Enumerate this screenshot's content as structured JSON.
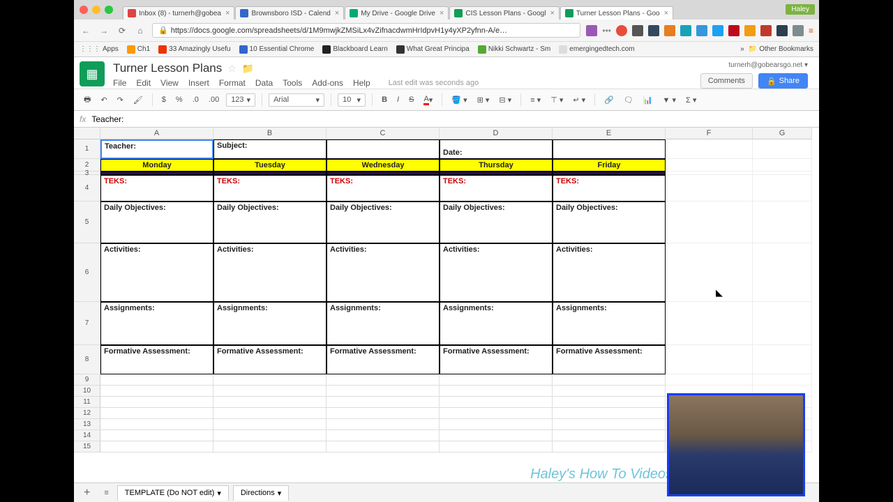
{
  "browser": {
    "user_badge": "Haley",
    "tabs": [
      {
        "label": "Inbox (8) - turnerh@gobea"
      },
      {
        "label": "Brownsboro ISD - Calend"
      },
      {
        "label": "My Drive - Google Drive"
      },
      {
        "label": "CIS Lesson Plans - Googl"
      },
      {
        "label": "Turner Lesson Plans - Goo"
      }
    ],
    "url": "https://docs.google.com/spreadsheets/d/1M9mwjkZMSiLx4vZifnacdwmHrIdpvH1y4yXP2yfnn-A/e…",
    "bookmarks": {
      "apps": "Apps",
      "items": [
        "Ch1",
        "33 Amazingly Usefu",
        "10 Essential Chrome",
        "Blackboard Learn",
        "What Great Principa",
        "Nikki Schwartz - Sm",
        "emergingedtech.com"
      ],
      "other": "Other Bookmarks"
    }
  },
  "sheets": {
    "doc_title": "Turner Lesson Plans",
    "user_email": "turnerh@gobearsgo.net",
    "menus": [
      "File",
      "Edit",
      "View",
      "Insert",
      "Format",
      "Data",
      "Tools",
      "Add-ons",
      "Help"
    ],
    "last_edit": "Last edit was seconds ago",
    "comments_btn": "Comments",
    "share_btn": "Share",
    "toolbar": {
      "font": "Arial",
      "size": "10",
      "numfmt": "123"
    },
    "fx_value": "Teacher:",
    "columns": [
      "A",
      "B",
      "C",
      "D",
      "E",
      "F",
      "G"
    ],
    "rows": [
      "1",
      "2",
      "3",
      "4",
      "5",
      "6",
      "7",
      "8",
      "9",
      "10",
      "11",
      "12",
      "13",
      "14",
      "15"
    ],
    "sheet_tabs": [
      "TEMPLATE (Do NOT edit)",
      "Directions"
    ]
  },
  "lesson_plan": {
    "header": {
      "teacher": "Teacher:",
      "subject": "Subject:",
      "date": "Date:"
    },
    "days": [
      "Monday",
      "Tuesday",
      "Wednesday",
      "Thursday",
      "Friday"
    ],
    "row_labels": {
      "teks": "TEKS:",
      "objectives": "Daily Objectives:",
      "activities": "Activities:",
      "assignments": "Assignments:",
      "assessment": "Formative Assessment:"
    }
  },
  "watermark": "Haley's How To Videos"
}
